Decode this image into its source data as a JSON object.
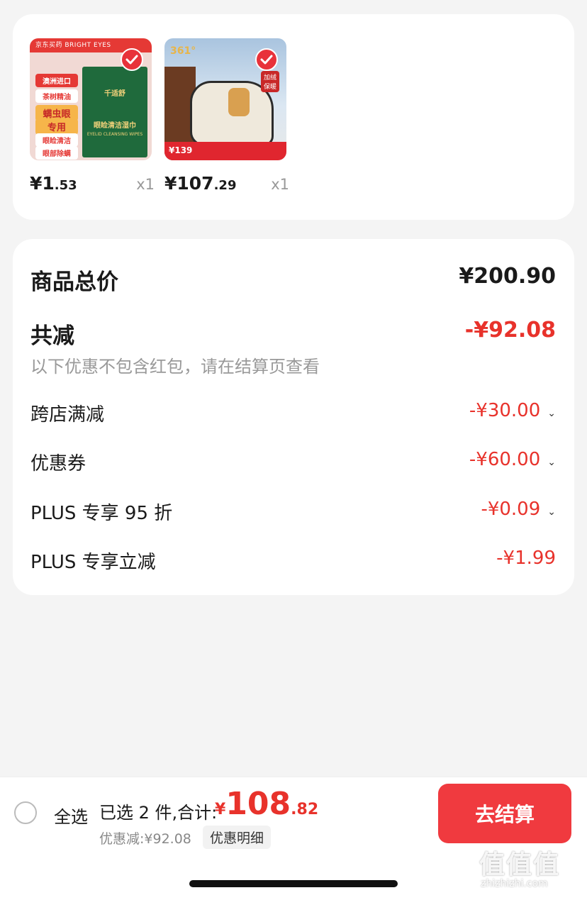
{
  "products": [
    {
      "price_main": "¥1",
      "price_cents": ".53",
      "qty": "x1",
      "thumb": {
        "top_bar": "京东买药 BRIGHT EYES",
        "tags": [
          "澳洲进口",
          "茶树精油",
          "螨虫眼",
          "专用",
          "眼睑清洁",
          "眼部除螨"
        ],
        "pack_title": "千适舒",
        "pack_text": "眼睑清洁湿巾",
        "pack_en": "EYELID CLEANSING WIPES"
      }
    },
    {
      "price_main": "¥107",
      "price_cents": ".29",
      "qty": "x1",
      "thumb": {
        "brand": "361°",
        "badge": "加绒保暖",
        "banner_price": "¥139"
      }
    }
  ],
  "summary": {
    "total_label": "商品总价",
    "total_value": "¥200.90",
    "reduce_label": "共减",
    "reduce_value": "-¥92.08",
    "note": "以下优惠不包含红包，请在结算页查看",
    "items": [
      {
        "label": "跨店满减",
        "value": "-¥30.00",
        "expandable": true
      },
      {
        "label": "优惠券",
        "value": "-¥60.00",
        "expandable": true
      },
      {
        "label": "PLUS 专享 95 折",
        "value": "-¥0.09",
        "expandable": true
      },
      {
        "label": "PLUS 专享立减",
        "value": "-¥1.99",
        "expandable": false
      }
    ]
  },
  "bottom_bar": {
    "select_all": "全选",
    "selected_text": "已选 2 件,合计:",
    "total_yen": "¥",
    "total_int": "108",
    "total_dec": ".82",
    "discount_text": "优惠减:¥92.08",
    "detail_button": "优惠明细",
    "checkout_button": "去结算"
  },
  "watermark": {
    "text": "值值值",
    "url": "zhizhizhi.com"
  },
  "colors": {
    "accent_red": "#e8322b",
    "checkout_red": "#f03a3f",
    "background": "#f4f4f4"
  }
}
